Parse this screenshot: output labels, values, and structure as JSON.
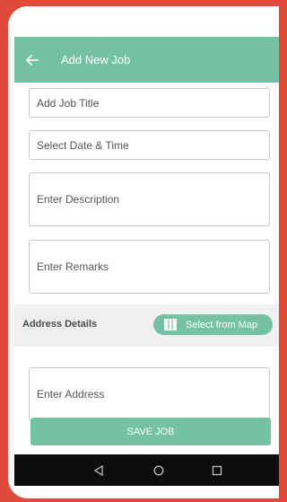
{
  "appbar": {
    "title": "Add New Job",
    "back_icon": "arrow-left-icon"
  },
  "form": {
    "job_title_placeholder": "Add Job Title",
    "date_time_placeholder": "Select Date & Time",
    "description_placeholder": "Enter Description",
    "remarks_placeholder": "Enter Remarks"
  },
  "address": {
    "section_label": "Address Details",
    "map_button_label": "Select from Map",
    "map_icon": "map-icon",
    "address_placeholder": "Enter Address"
  },
  "actions": {
    "save_label": "SAVE JOB"
  },
  "navbar": {
    "back": "back-triangle-icon",
    "home": "home-circle-icon",
    "recents": "recents-square-icon"
  },
  "colors": {
    "accent": "#74c2a3",
    "background": "#e04a3a",
    "navbar": "#0d0d0d"
  }
}
